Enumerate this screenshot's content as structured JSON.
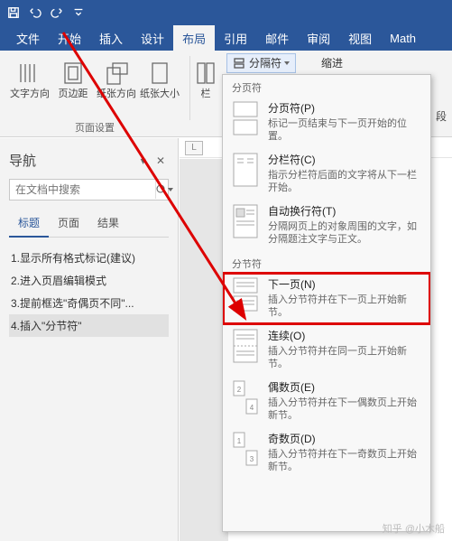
{
  "titlebar": {
    "icons": [
      "save",
      "undo",
      "redo",
      "customize"
    ]
  },
  "ribbon": {
    "tabs": [
      "文件",
      "开始",
      "插入",
      "设计",
      "布局",
      "引用",
      "邮件",
      "审阅",
      "视图",
      "Math"
    ],
    "active": "布局",
    "group_page_setup_label": "页面设置",
    "btn_text_direction": "文字方向",
    "btn_margins": "页边距",
    "btn_orientation": "纸张方向",
    "btn_size": "纸张大小",
    "btn_columns": "栏",
    "menu_breaks": "分隔符",
    "indent_label": "缩进",
    "right_strip": "段"
  },
  "navigation": {
    "title": "导航",
    "search_placeholder": "在文档中搜索",
    "tabs": [
      "标题",
      "页面",
      "结果"
    ],
    "active_tab": "标题",
    "items": [
      "1.显示所有格式标记(建议)",
      "2.进入页眉编辑模式",
      "3.提前框选\"奇偶页不同\"...",
      "4.插入\"分节符\""
    ],
    "selected_index": 3
  },
  "ruler_corner": "L",
  "breaks_menu": {
    "section1_title": "分页符",
    "items1": [
      {
        "title": "分页符(P)",
        "desc": "标记一页结束与下一页开始的位置。"
      },
      {
        "title": "分栏符(C)",
        "desc": "指示分栏符后面的文字将从下一栏开始。"
      },
      {
        "title": "自动换行符(T)",
        "desc": "分隔网页上的对象周围的文字，如分隔题注文字与正文。"
      }
    ],
    "section2_title": "分节符",
    "items2": [
      {
        "title": "下一页(N)",
        "desc": "插入分节符并在下一页上开始新节。"
      },
      {
        "title": "连续(O)",
        "desc": "插入分节符并在同一页上开始新节。"
      },
      {
        "title": "偶数页(E)",
        "desc": "插入分节符并在下一偶数页上开始新节。"
      },
      {
        "title": "奇数页(D)",
        "desc": "插入分节符并在下一奇数页上开始新节。"
      }
    ],
    "highlight_index": 0
  },
  "watermark": "知乎 @小木船"
}
